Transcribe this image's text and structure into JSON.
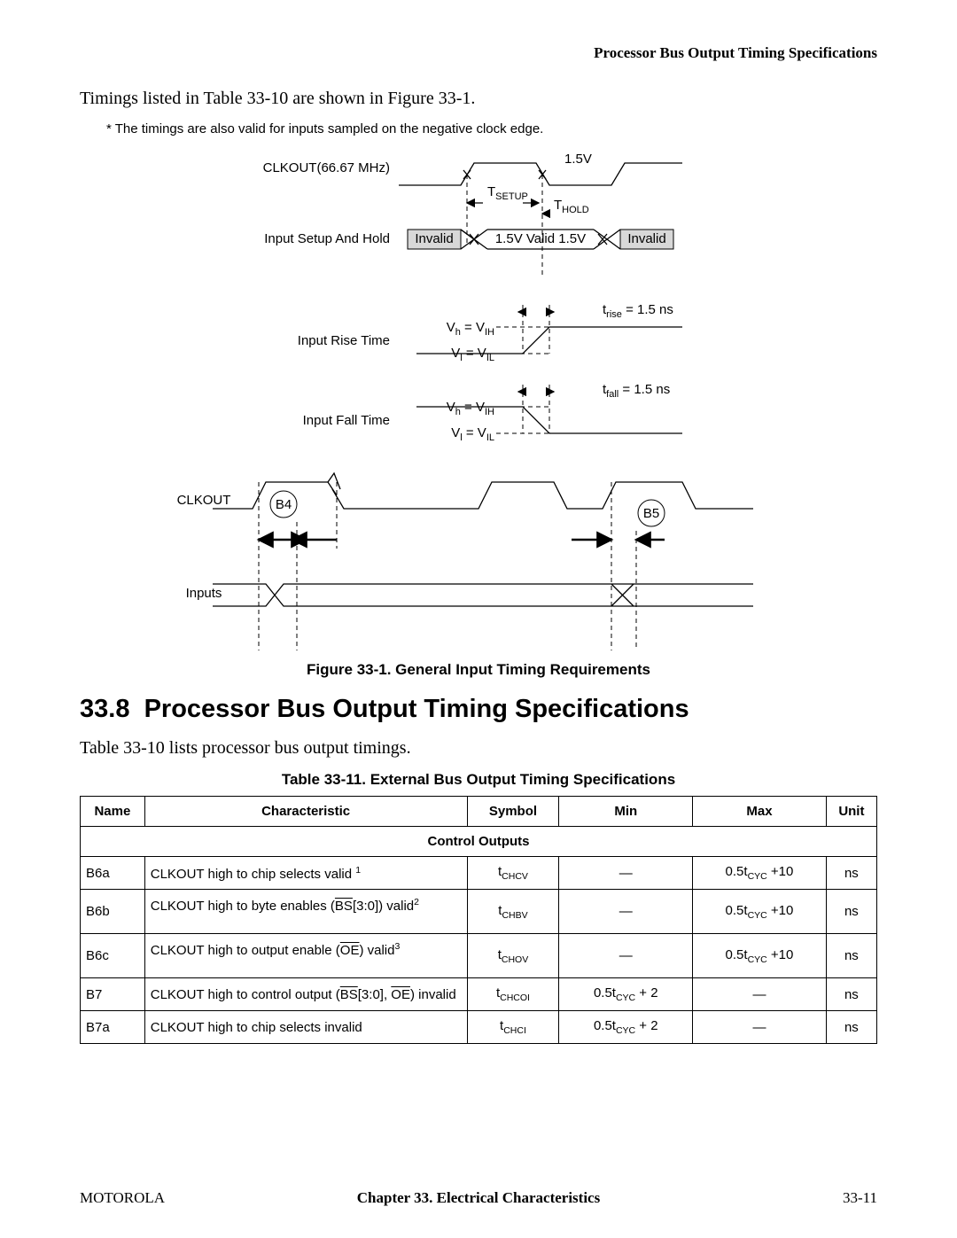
{
  "header_right": "Processor Bus Output Timing Specifications",
  "intro": "Timings listed in Table 33-10 are shown in Figure 33-1.",
  "footnote_star": "* The timings are also valid for inputs sampled on the negative clock edge.",
  "diagram": {
    "clkout_label": "CLKOUT(66.67 MHz)",
    "v15": "1.5V",
    "t_setup": "T",
    "t_setup_sub": "SETUP",
    "t_hold": "T",
    "t_hold_sub": "HOLD",
    "input_setup_hold": "Input Setup And Hold",
    "invalid": "Invalid",
    "valid_mid": "1.5V  Valid  1.5V",
    "input_rise": "Input Rise Time",
    "input_fall": "Input Fall Time",
    "vh_eq": "V",
    "vh_sub": "h",
    "vih": "V",
    "vih_sub": "IH",
    "vl_eq": "V",
    "vl_sub": "l",
    "vil": "V",
    "vil_sub": "IL",
    "trise": "t",
    "trise_sub": "rise",
    "trise_val": " = 1.5 ns",
    "tfall": "t",
    "tfall_sub": "fall",
    "tfall_val": " = 1.5 ns",
    "clkout2": "CLKOUT",
    "inputs": "Inputs",
    "b4": "B4",
    "b5": "B5"
  },
  "fig_caption": "Figure 33-1. General Input Timing Requirements",
  "section_num": "33.8",
  "section_title": "Processor Bus Output Timing Specifications",
  "section_intro": "Table 33-10 lists processor bus output timings.",
  "table_caption": "Table 33-11. External Bus Output Timing Specifications",
  "table": {
    "headers": {
      "name": "Name",
      "char": "Characteristic",
      "sym": "Symbol",
      "min": "Min",
      "max": "Max",
      "unit": "Unit"
    },
    "section_row": "Control Outputs",
    "rows": [
      {
        "name": "B6a",
        "char_pre": "CLKOUT high to chip selects valid ",
        "note": "1",
        "sym_sub": "CHCV",
        "min": "—",
        "max_pre": "0.5t",
        "max_sub": "CYC",
        "max_post": " +10",
        "unit": "ns"
      },
      {
        "name": "B6b",
        "char_pre": "CLKOUT high to byte enables (",
        "over1": "BS",
        "char_mid": "[3:0]) valid",
        "note": "2",
        "sym_sub": "CHBV",
        "min": "—",
        "max_pre": "0.5t",
        "max_sub": "CYC",
        "max_post": " +10",
        "unit": "ns"
      },
      {
        "name": "B6c",
        "char_pre": "CLKOUT high to output enable (",
        "over1": "OE",
        "char_mid": ") valid",
        "note": "3",
        "sym_sub": "CHOV",
        "min": "—",
        "max_pre": "0.5t",
        "max_sub": "CYC",
        "max_post": " +10",
        "unit": "ns"
      },
      {
        "name": "B7",
        "char_pre": "CLKOUT high to control output (",
        "over1": "BS",
        "char_mid": "[3:0], ",
        "over2": "OE",
        "char_post": ") invalid",
        "sym_sub": "CHCOI",
        "min_pre": "0.5t",
        "min_sub": "CYC",
        "min_post": " + 2",
        "max": "—",
        "unit": "ns"
      },
      {
        "name": "B7a",
        "char_pre": "CLKOUT high to chip selects invalid",
        "sym_sub": "CHCI",
        "min_pre": "0.5t",
        "min_sub": "CYC",
        "min_post": " + 2",
        "max": "—",
        "unit": "ns"
      }
    ]
  },
  "footer": {
    "left": "MOTOROLA",
    "center": "Chapter 33. Electrical Characteristics",
    "right": "33-11"
  }
}
